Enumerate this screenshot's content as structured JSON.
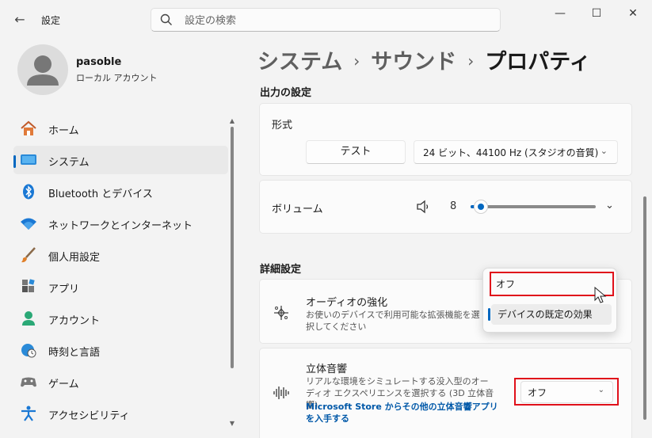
{
  "window": {
    "title": "設定",
    "minimize": "—",
    "maximize": "☐",
    "close": "✕"
  },
  "search": {
    "placeholder": "設定の検索"
  },
  "user": {
    "name": "pasoble",
    "account_type": "ローカル アカウント"
  },
  "nav": [
    {
      "label": "ホーム",
      "icon": "home-icon"
    },
    {
      "label": "システム",
      "icon": "system-icon",
      "selected": true
    },
    {
      "label": "Bluetooth とデバイス",
      "icon": "bluetooth-icon"
    },
    {
      "label": "ネットワークとインターネット",
      "icon": "wifi-icon"
    },
    {
      "label": "個人用設定",
      "icon": "brush-icon"
    },
    {
      "label": "アプリ",
      "icon": "apps-icon"
    },
    {
      "label": "アカウント",
      "icon": "account-icon"
    },
    {
      "label": "時刻と言語",
      "icon": "clock-globe-icon"
    },
    {
      "label": "ゲーム",
      "icon": "gamepad-icon"
    },
    {
      "label": "アクセシビリティ",
      "icon": "accessibility-icon"
    }
  ],
  "breadcrumb": {
    "level1": "システム",
    "level2": "サウンド",
    "current": "プロパティ",
    "separator": "›"
  },
  "output": {
    "section_title": "出力の設定",
    "format_label": "形式",
    "test_button": "テスト",
    "format_value": "24 ビット、44100 Hz (スタジオの音質)",
    "volume_label": "ボリューム",
    "volume_value": "8",
    "volume_fraction": 0.08
  },
  "advanced": {
    "section_title": "詳細設定",
    "enhance_title": "オーディオの強化",
    "enhance_desc": "お使いのデバイスで利用可能な拡張機能を選択してください",
    "spatial_title": "立体音響",
    "spatial_desc": "リアルな環境をシミュレートする没入型のオーディオ エクスペリエンスを選択する (3D 立体音響)",
    "spatial_link": "Microsoft Store からその他の立体音響アプリを入手する",
    "spatial_value": "オフ"
  },
  "enhance_menu": {
    "options": [
      "オフ",
      "デバイスの既定の効果"
    ],
    "selected_index": 1
  },
  "colors": {
    "accent": "#0067c0",
    "highlight": "#e0101a"
  }
}
